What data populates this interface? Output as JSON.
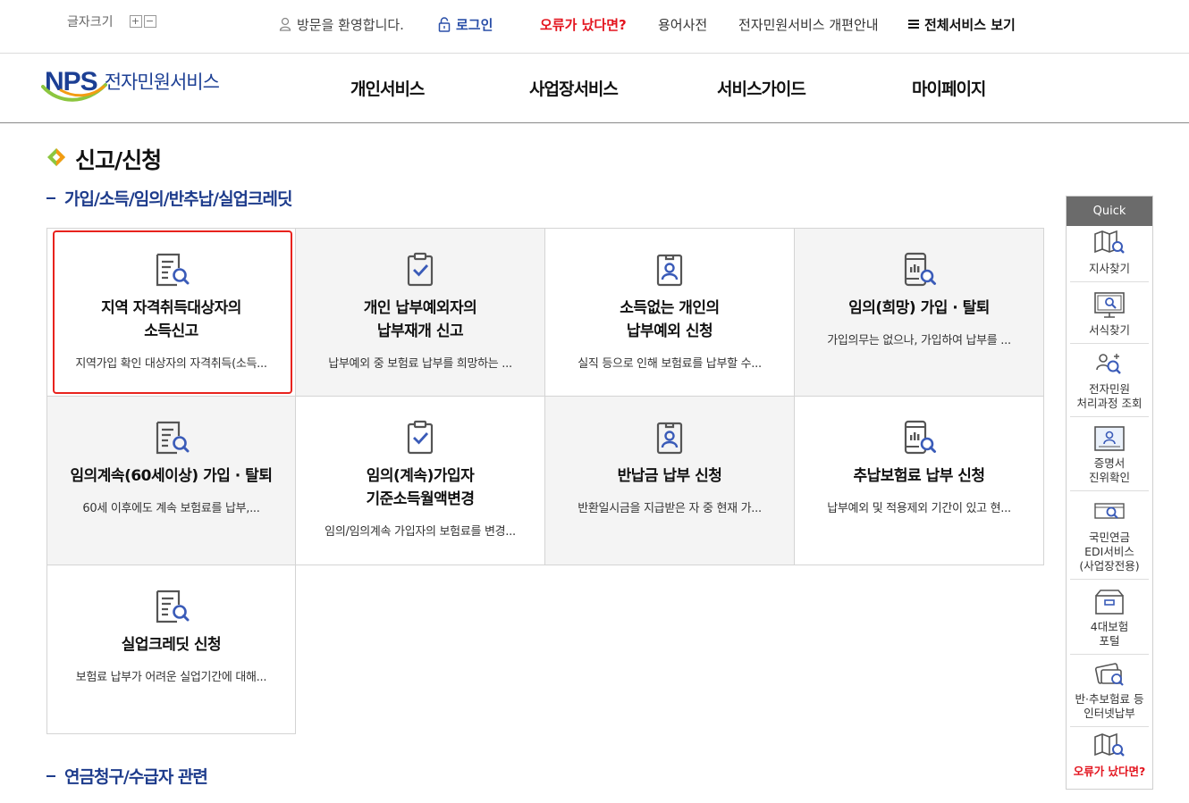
{
  "topbar": {
    "font_size_label": "글자크기",
    "plus": "+",
    "minus": "−",
    "welcome": "방문을 환영합니다.",
    "login": "로그인",
    "error_report": "오류가 났다면?",
    "dictionary": "용어사전",
    "renewal_guide": "전자민원서비스 개편안내",
    "all_services": "전체서비스 보기"
  },
  "header": {
    "logo_mark": "NPS",
    "logo_text": "전자민원서비스",
    "nav": [
      "개인서비스",
      "사업장서비스",
      "서비스가이드",
      "마이페이지"
    ]
  },
  "page": {
    "title": "신고/신청",
    "section1": "가입/소득/임의/반추납/실업크레딧",
    "section2": "연금청구/수급자 관련"
  },
  "cards": [
    {
      "icon": "document-search-icon",
      "title": [
        "지역 자격취득대상자의",
        "소득신고"
      ],
      "desc": "지역가입 확인 대상자의 자격취득(소득..."
    },
    {
      "icon": "clipboard-check-icon",
      "title": [
        "개인 납부예외자의",
        "납부재개 신고"
      ],
      "desc": "납부예외 중 보험료 납부를 희망하는 ..."
    },
    {
      "icon": "id-badge-icon",
      "title": [
        "소득없는 개인의",
        "납부예외 신청"
      ],
      "desc": "실직 등으로 인해 보험료를 납부할 수..."
    },
    {
      "icon": "mobile-search-icon",
      "title": [
        "임의(희망) 가입 · 탈퇴"
      ],
      "desc": "가입의무는 없으나, 가입하여 납부를 ..."
    },
    {
      "icon": "document-search-icon",
      "title": [
        "임의계속(60세이상) 가입 · 탈퇴"
      ],
      "desc": "60세 이후에도 계속 보험료를 납부,..."
    },
    {
      "icon": "clipboard-check-icon",
      "title": [
        "임의(계속)가입자",
        "기준소득월액변경"
      ],
      "desc": "임의/임의계속 가입자의 보험료를 변경..."
    },
    {
      "icon": "id-badge-icon",
      "title": [
        "반납금 납부 신청"
      ],
      "desc": "반환일시금을 지급받은 자 중 현재 가..."
    },
    {
      "icon": "mobile-search-icon",
      "title": [
        "추납보험료 납부 신청"
      ],
      "desc": "납부예외 및 적용제외 기간이 있고 현..."
    },
    {
      "icon": "document-search-icon",
      "title": [
        "실업크레딧 신청"
      ],
      "desc": "보험료 납부가 어려운 실업기간에 대해..."
    }
  ],
  "quick": {
    "header": "Quick",
    "items": [
      {
        "icon": "map-search-icon",
        "label": [
          "지사찾기"
        ]
      },
      {
        "icon": "monitor-search-icon",
        "label": [
          "서식찾기"
        ]
      },
      {
        "icon": "people-search-icon",
        "label": [
          "전자민원",
          "처리과정 조회"
        ]
      },
      {
        "icon": "certificate-icon",
        "label": [
          "증명서",
          "진위확인"
        ]
      },
      {
        "icon": "edi-icon",
        "label": [
          "국민연금",
          "EDI서비스",
          "(사업장전용)"
        ]
      },
      {
        "icon": "portal-box-icon",
        "label": [
          "4대보험",
          "포털"
        ]
      },
      {
        "icon": "card-payment-icon",
        "label": [
          "반·추보험료 등",
          "인터넷납부"
        ]
      },
      {
        "icon": "map-search-icon",
        "label": [
          "오류가 났다면?"
        ]
      }
    ]
  },
  "colors": {
    "brand_blue": "#1c3f94",
    "section_blue": "#1e3c8c",
    "alert_red": "#e3141e",
    "selection_red": "#e8221d",
    "cell_gray": "#f4f4f4",
    "quick_head": "#6b6b6b"
  }
}
